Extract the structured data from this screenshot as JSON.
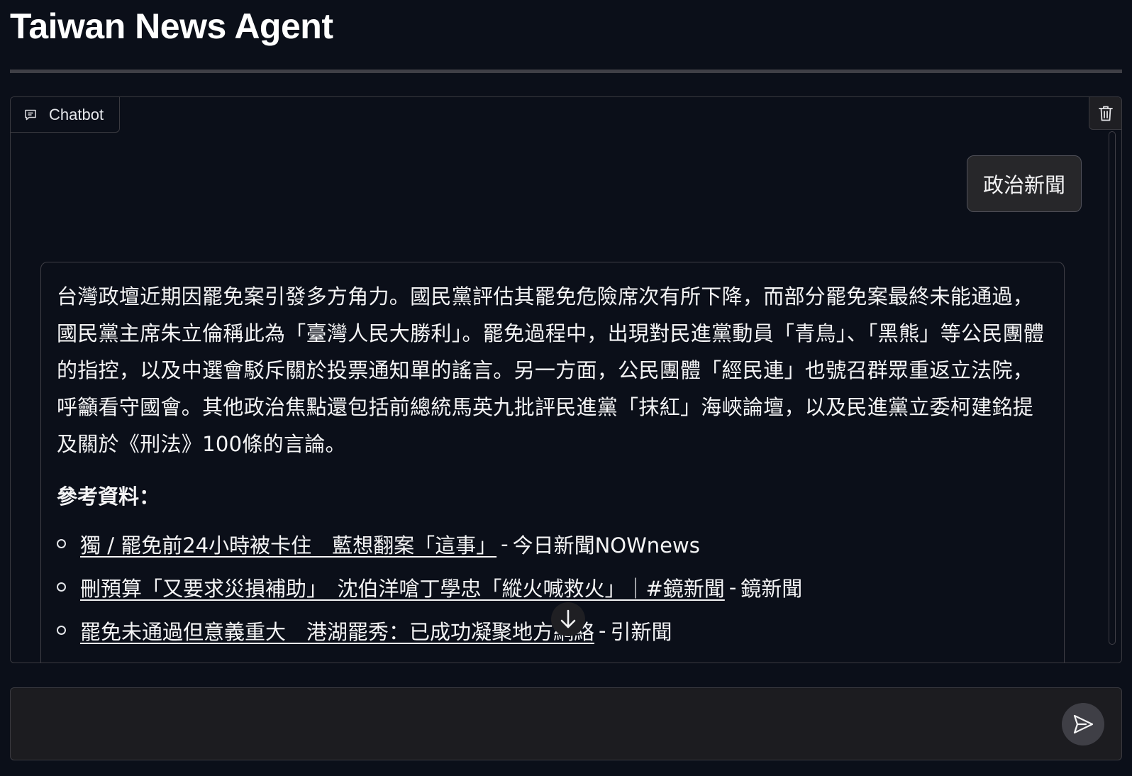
{
  "app": {
    "title": "Taiwan News Agent"
  },
  "chatbot": {
    "label": "Chatbot",
    "label_icon": "chat-bubble-icon",
    "clear_icon": "trash-icon",
    "user_message": "政治新聞",
    "bot_message": "台灣政壇近期因罷免案引發多方角力。國民黨評估其罷免危險席次有所下降，而部分罷免案最終未能通過，國民黨主席朱立倫稱此為「臺灣人民大勝利」。罷免過程中，出現對民進黨動員「青鳥」、「黑熊」等公民團體的指控，以及中選會駁斥關於投票通知單的謠言。另一方面，公民團體「經民連」也號召群眾重返立法院，呼籲看守國會。其他政治焦點還包括前總統馬英九批評民進黨「抹紅」海峽論壇，以及民進黨立委柯建銘提及關於《刑法》100條的言論。",
    "references_heading": "參考資料：",
    "references": [
      {
        "title": "獨 / 罷免前24小時被卡住　藍想翻案「這事」",
        "source": "今日新聞NOWnews"
      },
      {
        "title": "刪預算「又要求災損補助」　沈伯洋嗆丁學忠「縱火喊救火」｜#鏡新聞",
        "source": "鏡新聞"
      },
      {
        "title": "罷免未通過但意義重大　港湖罷秀：已成功凝聚地方網絡",
        "source": "引新聞"
      }
    ],
    "scroll_down_icon": "arrow-down-icon"
  },
  "composer": {
    "value": "",
    "placeholder": "",
    "send_icon": "send-icon"
  },
  "colors": {
    "background": "#0b0f19",
    "border": "#3a3a40",
    "user_bubble": "#27272a",
    "input_background": "#1c1c20",
    "send_button": "#3f3f46"
  }
}
